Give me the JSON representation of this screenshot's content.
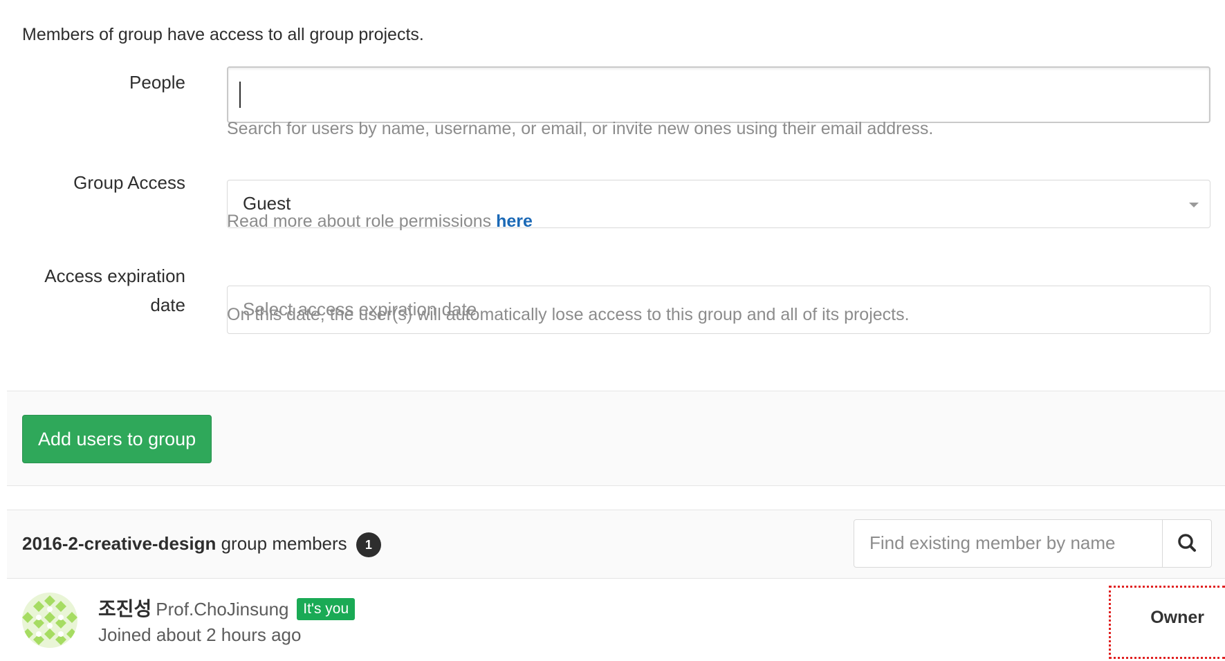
{
  "intro_text": "Members of group have access to all group projects.",
  "form": {
    "people": {
      "label": "People",
      "value": "",
      "help": "Search for users by name, username, or email, or invite new ones using their email address."
    },
    "group_access": {
      "label": "Group Access",
      "selected": "Guest",
      "help_prefix": "Read more about role permissions ",
      "help_link": "here"
    },
    "expiration": {
      "label_line1": "Access expiration",
      "label_line2": "date",
      "placeholder": "Select access expiration date",
      "help": "On this date, the user(s) will automatically lose access to this group and all of its projects."
    },
    "submit_label": "Add users to group"
  },
  "members": {
    "group_name": "2016-2-creative-design",
    "title_suffix": " group members",
    "count": "1",
    "search_placeholder": "Find existing member by name",
    "search_icon": "search-icon",
    "list": [
      {
        "name": "조진성",
        "username": "Prof.ChoJinsung",
        "badge": "It's you",
        "joined": "Joined about 2 hours ago",
        "role": "Owner"
      }
    ]
  },
  "colors": {
    "primary_green": "#2fa85a",
    "badge_green": "#1aaa55",
    "link_blue": "#1b69b6",
    "highlight_red": "#e02020"
  }
}
